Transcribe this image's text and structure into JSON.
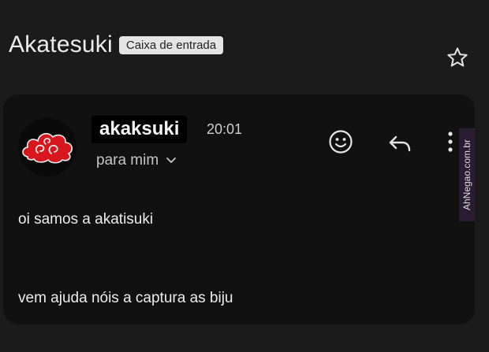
{
  "email": {
    "subject": "Akatesuki",
    "label": "Caixa de entrada",
    "sender": "akaksuki",
    "time": "20:01",
    "recipient": "para mim",
    "body_lines": [
      "oi samos a akatisuki",
      "vem ajuda nóis a captura as biju"
    ]
  },
  "watermark": "AhNegao.com.br",
  "icons": {
    "star": "star-icon",
    "avatar": "red-cloud-icon",
    "chevron": "chevron-down-icon",
    "emoji": "emoji-smile-icon",
    "reply": "reply-arrow-icon",
    "more": "more-vertical-icon"
  },
  "colors": {
    "background": "#1b1b1b",
    "card": "#111111",
    "cloud": "#d8161d",
    "label_chip": "#e4e4e4"
  }
}
